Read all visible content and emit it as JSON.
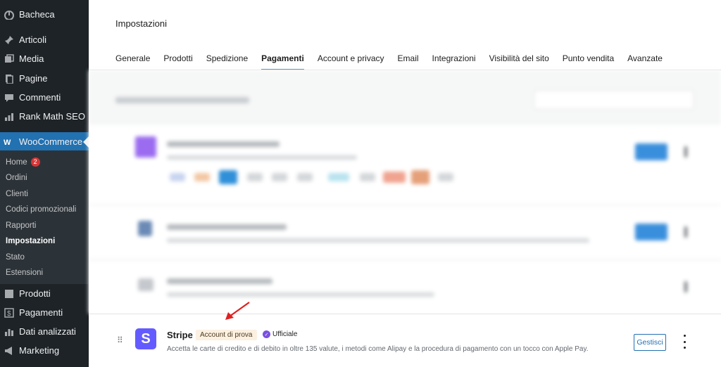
{
  "sidebar": {
    "items": [
      {
        "label": "Bacheca",
        "icon": "dashboard-icon"
      },
      {
        "label": "Articoli",
        "icon": "pin-icon"
      },
      {
        "label": "Media",
        "icon": "media-icon"
      },
      {
        "label": "Pagine",
        "icon": "pages-icon"
      },
      {
        "label": "Commenti",
        "icon": "comments-icon"
      },
      {
        "label": "Rank Math SEO",
        "icon": "chart-icon"
      }
    ],
    "woocommerce": {
      "label": "WooCommerce",
      "icon": "woocommerce-icon"
    },
    "submenu": [
      {
        "label": "Home",
        "badge": "2"
      },
      {
        "label": "Ordini"
      },
      {
        "label": "Clienti"
      },
      {
        "label": "Codici promozionali"
      },
      {
        "label": "Rapporti"
      },
      {
        "label": "Impostazioni",
        "current": true
      },
      {
        "label": "Stato"
      },
      {
        "label": "Estensioni"
      }
    ],
    "bottom_items": [
      {
        "label": "Prodotti",
        "icon": "products-icon"
      },
      {
        "label": "Pagamenti",
        "icon": "payments-icon"
      },
      {
        "label": "Dati analizzati",
        "icon": "analytics-icon"
      },
      {
        "label": "Marketing",
        "icon": "marketing-icon"
      }
    ]
  },
  "main": {
    "title": "Impostazioni",
    "tabs": [
      {
        "label": "Generale"
      },
      {
        "label": "Prodotti"
      },
      {
        "label": "Spedizione"
      },
      {
        "label": "Pagamenti",
        "active": true
      },
      {
        "label": "Account e privacy"
      },
      {
        "label": "Email"
      },
      {
        "label": "Integrazioni"
      },
      {
        "label": "Visibilità del sito"
      },
      {
        "label": "Punto vendita"
      },
      {
        "label": "Avanzate"
      }
    ]
  },
  "stripe": {
    "logo_letter": "S",
    "title": "Stripe",
    "badge": "Account di prova",
    "official_label": "Ufficiale",
    "description": "Accetta le carte di credito e di debito in oltre 135 valute, i metodi come Alipay e la procedura di pagamento con un tocco con Apple Pay.",
    "manage_label": "Gestisci"
  },
  "colors": {
    "sidebar_bg": "#1d2327",
    "accent": "#2271b1",
    "stripe_purple": "#635bff",
    "badge_red": "#d63638",
    "annotation_arrow": "#e02020"
  }
}
